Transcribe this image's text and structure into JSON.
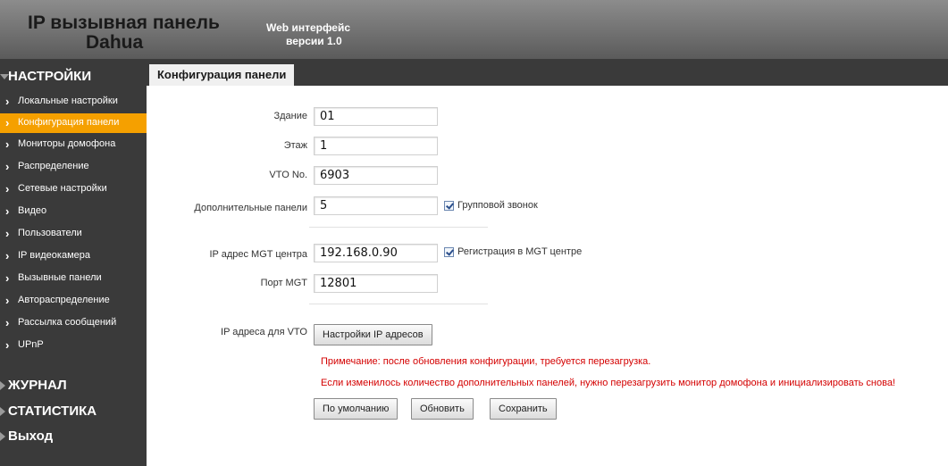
{
  "header": {
    "title_line1": "IP вызывная панель",
    "title_line2": "Dahua",
    "subtitle_line1": "Web интерфейс",
    "subtitle_line2": "версии 1.0"
  },
  "sidebar": {
    "settings_label": "НАСТРОЙКИ",
    "items": [
      {
        "label": "Локальные настройки",
        "active": false
      },
      {
        "label": "Конфигурация панели",
        "active": true
      },
      {
        "label": "Мониторы домофона",
        "active": false
      },
      {
        "label": "Распределение",
        "active": false
      },
      {
        "label": "Сетевые настройки",
        "active": false
      },
      {
        "label": "Видео",
        "active": false
      },
      {
        "label": "Пользователи",
        "active": false
      },
      {
        "label": "IP видеокамера",
        "active": false
      },
      {
        "label": "Вызывные панели",
        "active": false
      },
      {
        "label": "Автораспределение",
        "active": false
      },
      {
        "label": "Рассылка сообщений",
        "active": false
      },
      {
        "label": "UPnP",
        "active": false
      }
    ],
    "journal_label": "ЖУРНАЛ",
    "stats_label": "СТАТИСТИКА",
    "exit_label": "Выход",
    "active_color": "#f5a000"
  },
  "tab": {
    "label": "Конфигурация панели"
  },
  "form": {
    "building": {
      "label": "Здание",
      "value": "01"
    },
    "floor": {
      "label": "Этаж",
      "value": "1"
    },
    "vto_no": {
      "label": "VTO No.",
      "value": "6903"
    },
    "extra_panels": {
      "label": "Дополнительные панели",
      "value": "5"
    },
    "group_call": {
      "label": "Групповой звонок",
      "checked": true
    },
    "mgt_ip": {
      "label": "IP адрес MGT центра",
      "value": "192.168.0.90"
    },
    "mgt_register": {
      "label": "Регистрация в MGT центре",
      "checked": true
    },
    "mgt_port": {
      "label": "Порт MGT",
      "value": "12801"
    },
    "vto_ips": {
      "label": "IP адреса для VTO",
      "button": "Настройки IP адресов"
    },
    "note1": "Примечание: после обновления конфигурации, требуется перезагрузка.",
    "note2": "Если изменилось количество дополнительных панелей, нужно перезагрузить монитор домофона и инициализировать снова!",
    "buttons": {
      "default": "По умолчанию",
      "refresh": "Обновить",
      "save": "Сохранить"
    }
  },
  "colors": {
    "note": "#d40000",
    "sidebar_bg": "#3a3a3a"
  }
}
